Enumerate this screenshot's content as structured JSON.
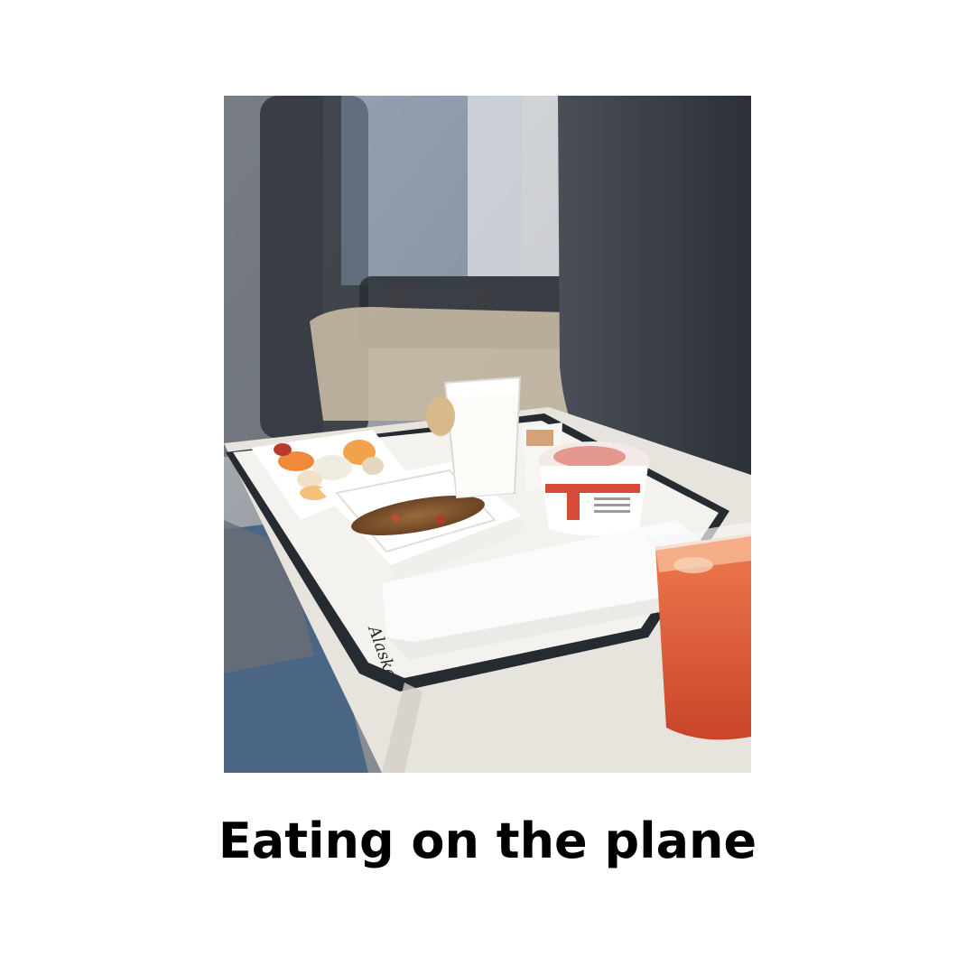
{
  "caption": "Eating on the plane",
  "photo": {
    "tray_brand": "Alaska",
    "colors": {
      "background": "#ffffff",
      "caption_text": "#000000",
      "juice": "#e0603a",
      "seat": "#3b3f46",
      "tray": "#eceae6"
    }
  }
}
